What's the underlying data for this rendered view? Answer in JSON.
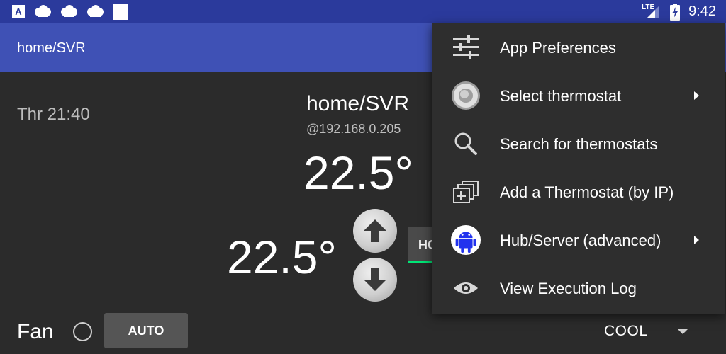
{
  "status_bar": {
    "time": "9:42",
    "network": "LTE",
    "icons": [
      "a-icon",
      "cloud-icon",
      "cloud-icon",
      "cloud-icon",
      "square-icon",
      "signal-icon",
      "battery-charging-icon"
    ]
  },
  "app_bar": {
    "title": "home/SVR"
  },
  "main": {
    "clock": "Thr 21:40",
    "thermostat_name": "home/SVR",
    "thermostat_ip": "@192.168.0.205",
    "current_temp": "22.5°",
    "set_temp": "22.5°",
    "mode_button_partial": "HO",
    "fan_label": "Fan",
    "fan_mode_button": "AUTO",
    "hvac_mode": "COOL"
  },
  "menu": {
    "items": [
      {
        "label": "App Preferences",
        "icon": "sliders-icon",
        "submenu": false
      },
      {
        "label": "Select thermostat",
        "icon": "thermostat-dial-icon",
        "submenu": true
      },
      {
        "label": "Search for thermostats",
        "icon": "magnifier-icon",
        "submenu": false
      },
      {
        "label": "Add a Thermostat (by IP)",
        "icon": "add-stack-icon",
        "submenu": false
      },
      {
        "label": "Hub/Server (advanced)",
        "icon": "android-icon",
        "submenu": true
      },
      {
        "label": "View Execution Log",
        "icon": "eye-icon",
        "submenu": false
      }
    ]
  },
  "colors": {
    "status_bar": "#2b3a9c",
    "app_bar": "#3f51b5",
    "background": "#2b2b2b",
    "menu_bg": "#2e2e2e",
    "accent_green": "#00e676",
    "android_blue": "#2233ee"
  }
}
